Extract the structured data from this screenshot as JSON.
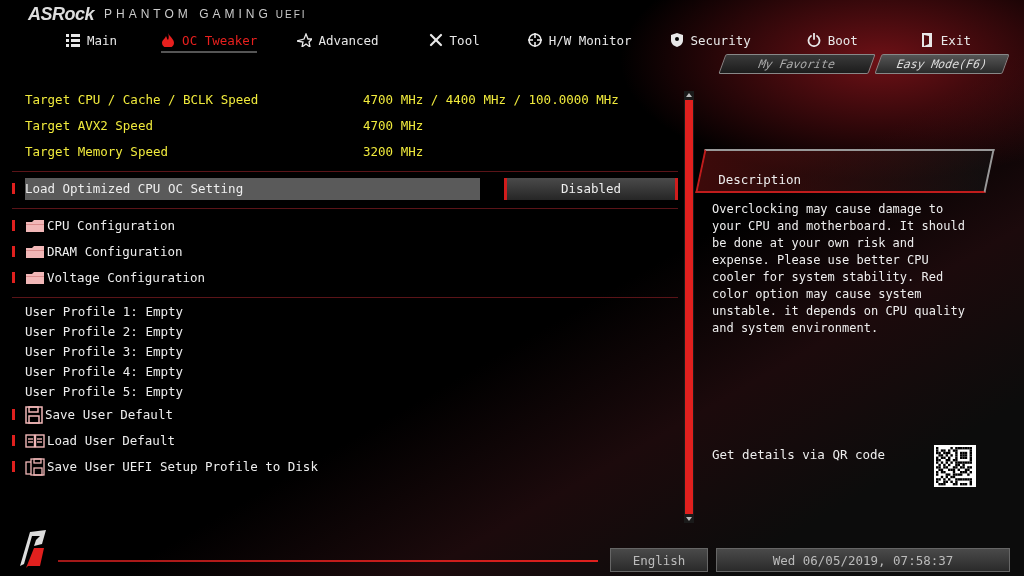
{
  "header": {
    "brand": "ASRock",
    "product": "PHANTOM GAMING",
    "suffix": "UEFI"
  },
  "tabs": [
    {
      "label": "Main",
      "selected": false
    },
    {
      "label": "OC Tweaker",
      "selected": true
    },
    {
      "label": "Advanced",
      "selected": false
    },
    {
      "label": "Tool",
      "selected": false
    },
    {
      "label": "H/W Monitor",
      "selected": false
    },
    {
      "label": "Security",
      "selected": false
    },
    {
      "label": "Boot",
      "selected": false
    },
    {
      "label": "Exit",
      "selected": false
    }
  ],
  "mode_buttons": [
    "My Favorite",
    "Easy Mode(F6)"
  ],
  "sections": [
    {
      "items": [
        {
          "kind": "info",
          "label": "Target CPU / Cache / BCLK Speed",
          "value": "4700 MHz / 4400 MHz / 100.0000 MHz"
        },
        {
          "kind": "info",
          "label": "Target AVX2 Speed",
          "value": "4700 MHz"
        },
        {
          "kind": "info",
          "label": "Target Memory Speed",
          "value": "3200 MHz"
        }
      ]
    },
    {
      "items": [
        {
          "kind": "setting",
          "label": "Load Optimized CPU OC Setting",
          "value": "Disabled",
          "selected": true
        }
      ]
    },
    {
      "items": [
        {
          "kind": "folder",
          "label": "CPU Configuration",
          "selected": false
        },
        {
          "kind": "folder",
          "label": "DRAM Configuration",
          "selected": false
        },
        {
          "kind": "folder",
          "label": "Voltage Configuration",
          "selected": false
        }
      ]
    },
    {
      "items": [
        {
          "kind": "profile",
          "label": "User Profile 1: Empty"
        },
        {
          "kind": "profile",
          "label": "User Profile 2: Empty"
        },
        {
          "kind": "profile",
          "label": "User Profile 3: Empty"
        },
        {
          "kind": "profile",
          "label": "User Profile 4: Empty"
        },
        {
          "kind": "profile",
          "label": "User Profile 5: Empty"
        },
        {
          "kind": "save",
          "label": "Save User Default",
          "selected": false
        },
        {
          "kind": "load",
          "label": "Load User Default",
          "selected": false
        },
        {
          "kind": "disk",
          "label": "Save User UEFI Setup Profile to Disk",
          "selected": false
        }
      ]
    }
  ],
  "description": {
    "title": "Description",
    "text": "Overclocking may cause damage to your CPU and motherboard. It should be done at your own risk and expense. Please use better CPU cooler for system stability. Red color option may cause system unstable. it depends on CPU quality and system environment.",
    "qr_label": "Get details via QR code"
  },
  "footer": {
    "language": "English",
    "datetime": "Wed 06/05/2019, 07:58:37"
  }
}
